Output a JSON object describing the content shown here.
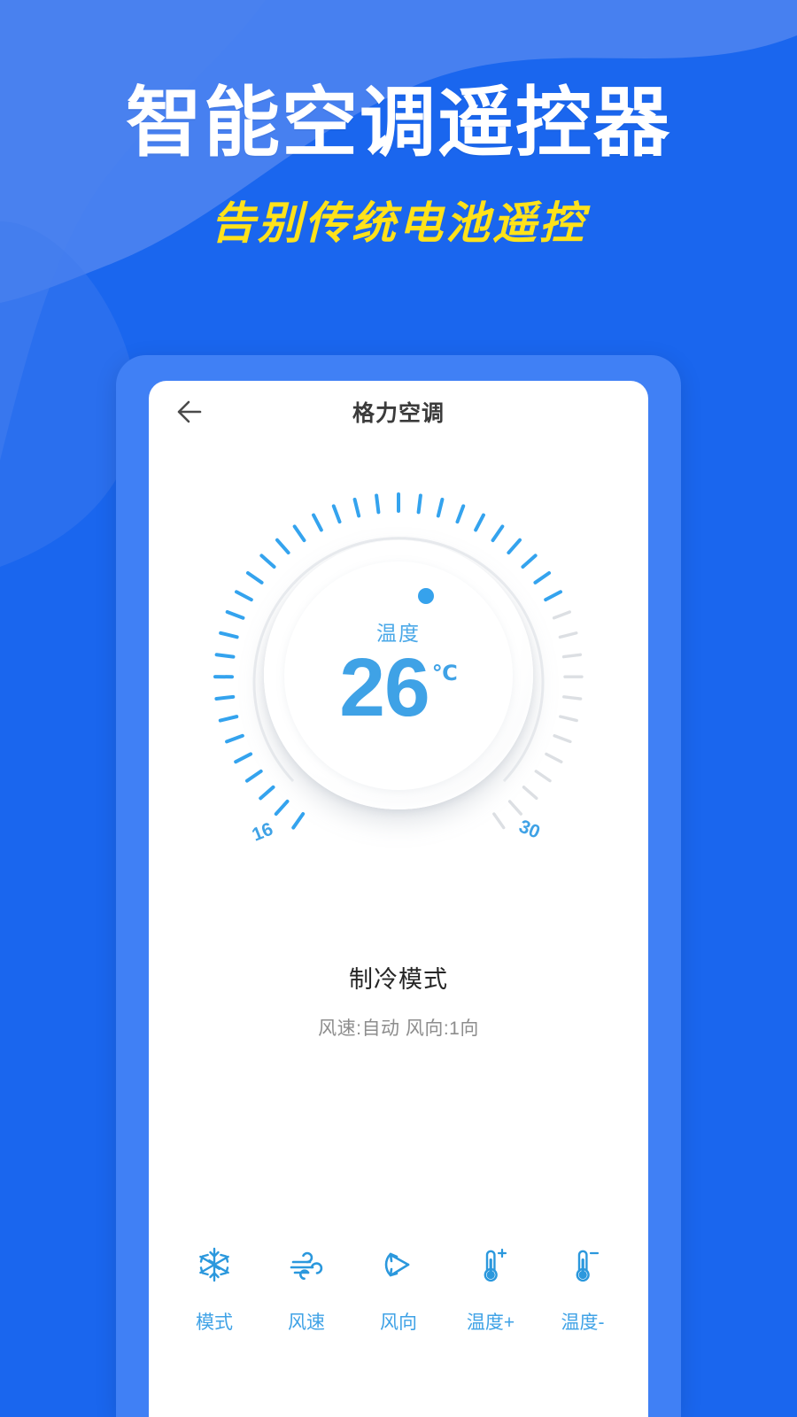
{
  "theme": {
    "bg_blue": "#1a66ee",
    "bg_blob_blue": "#4a82ef",
    "phone_frame_blue": "#4080f5",
    "accent_blue": "#3fa2e6",
    "title_white": "#ffffff",
    "subtitle_yellow": "#ffe21a",
    "tick_active": "#34a3ee",
    "tick_inactive": "#dcdfe3"
  },
  "hero": {
    "title": "智能空调遥控器",
    "subtitle": "告别传统电池遥控"
  },
  "app": {
    "header": {
      "back_icon": "back-arrow-icon",
      "title": "格力空调"
    },
    "dial": {
      "label": "温度",
      "value": "26",
      "unit": "℃",
      "min_label": "16",
      "max_label": "30",
      "min": 16,
      "max": 30,
      "current": 26,
      "tick_count": 43,
      "active_ticks": 31,
      "indicator_dot": "dial-position-dot"
    },
    "status": {
      "mode_name": "制冷模式",
      "detail": "风速:自动  风向:1向"
    },
    "controls": [
      {
        "icon": "snowflake-icon",
        "label": "模式"
      },
      {
        "icon": "wind-icon",
        "label": "风速"
      },
      {
        "icon": "swing-icon",
        "label": "风向"
      },
      {
        "icon": "thermometer-plus-icon",
        "label": "温度+"
      },
      {
        "icon": "thermometer-minus-icon",
        "label": "温度-"
      }
    ]
  }
}
